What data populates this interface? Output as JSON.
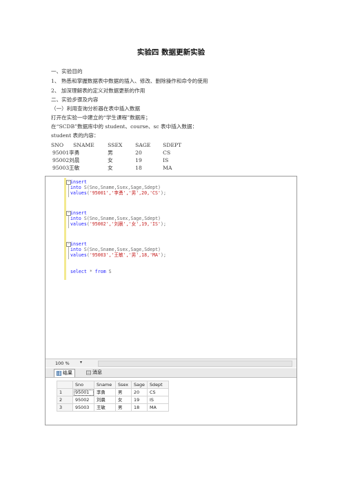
{
  "doc": {
    "title": "实验四  数据更新实验",
    "lines": [
      "一、实验目的",
      "1、   熟悉和掌握数据表中数据的插入、修改、删除操作和命令的使用",
      "2、   加深理解表的定义对数据更新的作用",
      "二、实验步骤及内容",
      "（一）利用查询分析器在表中插入数据",
      "打开在实验一中建立的“学生课程”数据库；",
      "在“SCDB”数据库中的 student、course、sc 表中插入数据：",
      "student 表的内容："
    ],
    "student_table": {
      "headers": [
        "SNO",
        "SNAME",
        "SSEX",
        "SAGE",
        "SDEPT"
      ],
      "rows": [
        [
          "95001",
          "李勇",
          "男",
          "20",
          "CS"
        ],
        [
          "95002",
          "刘晨",
          "女",
          "19",
          "IS"
        ],
        [
          "95003",
          "王敏",
          "女",
          "18",
          "MA"
        ]
      ]
    }
  },
  "screenshot": {
    "editor": {
      "blocks": [
        {
          "insert": "insert",
          "into_kw": "into",
          "into_tbl": "S(Sno,Sname,Ssex,Sage,Sdept)",
          "values_kw": "values",
          "open": "(",
          "vals": "'95001','李勇','男',20,'CS'",
          "close": ");"
        },
        {
          "insert": "insert",
          "into_kw": "into",
          "into_tbl": "S(Sno,Sname,Ssex,Sage,Sdept)",
          "values_kw": "values",
          "open": "(",
          "vals": "'95002','刘晨','女',19,'IS'",
          "close": ");"
        },
        {
          "insert": "insert",
          "into_kw": "into",
          "into_tbl": "S(Sno,Sname,Ssex,Sage,Sdept)",
          "values_kw": "values",
          "open": "(",
          "vals": "'95003','王敏','男',18,'MA'",
          "close": ");"
        }
      ],
      "select": {
        "kw": "select",
        "star": "*",
        "from_kw": "from",
        "tbl": "S"
      }
    },
    "zoom": "100 %",
    "tabs": {
      "results": "结果",
      "messages": "消息"
    },
    "results": {
      "headers": [
        "",
        "Sno",
        "Sname",
        "Ssex",
        "Sage",
        "Sdept"
      ],
      "rows": [
        [
          "1",
          "95001",
          "李勇",
          "男",
          "20",
          "CS"
        ],
        [
          "2",
          "95002",
          "刘晨",
          "女",
          "19",
          "IS"
        ],
        [
          "3",
          "95003",
          "王敏",
          "男",
          "18",
          "MA"
        ]
      ]
    }
  }
}
